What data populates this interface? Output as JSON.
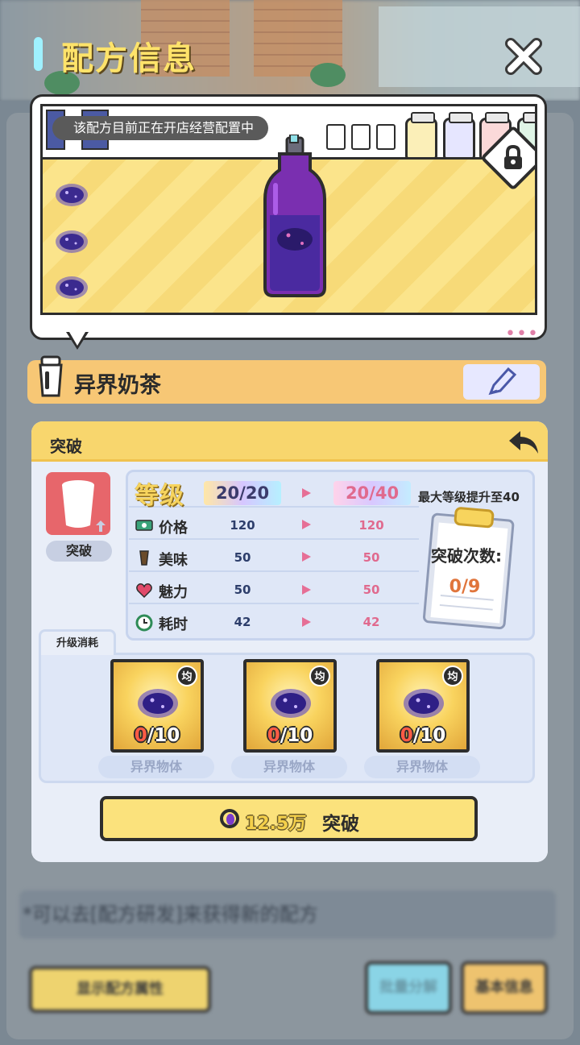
{
  "header": {
    "title": "配方信息"
  },
  "preview": {
    "banner": "该配方目前正在开店经营配置中",
    "dots": "•••"
  },
  "recipe": {
    "name": "异界奶茶"
  },
  "card": {
    "title": "突破",
    "breakthrough_label": "突破",
    "level_word": "等级",
    "level_current": "20/20",
    "level_new": "20/40",
    "max_note": "最大等级提升至40",
    "stats": [
      {
        "label": "价格",
        "current": "120",
        "new": "120",
        "icon": "money-icon",
        "color": "#3aa37a"
      },
      {
        "label": "美味",
        "current": "50",
        "new": "50",
        "icon": "cup-icon",
        "color": "#6a4b2a"
      },
      {
        "label": "魅力",
        "current": "50",
        "new": "50",
        "icon": "heart-icon",
        "color": "#e04a6a"
      },
      {
        "label": "耗时",
        "current": "42",
        "new": "42",
        "icon": "clock-icon",
        "color": "#2e8b57"
      }
    ],
    "clipboard": {
      "title": "突破次数:",
      "count": "0/9"
    },
    "cost": {
      "tab_label": "升级消耗",
      "items": [
        {
          "name": "异界物体",
          "have": "0",
          "need": "/10",
          "badge": "均"
        },
        {
          "name": "异界物体",
          "have": "0",
          "need": "/10",
          "badge": "均"
        },
        {
          "name": "异界物体",
          "have": "0",
          "need": "/10",
          "badge": "均"
        }
      ]
    },
    "button": {
      "price": "12.5万",
      "label": "突破"
    }
  },
  "background": {
    "hint": "*可以去[配方研发]来获得新的配方",
    "show_attr_button": "显示配方属性",
    "mid_button": "批量分解",
    "basic_info_button": "基本信息"
  },
  "colors": {
    "accent": "#ffe36a",
    "card_head": "#f8d66d",
    "name_bar": "#f7c775",
    "gem": "#3b2a8f"
  }
}
